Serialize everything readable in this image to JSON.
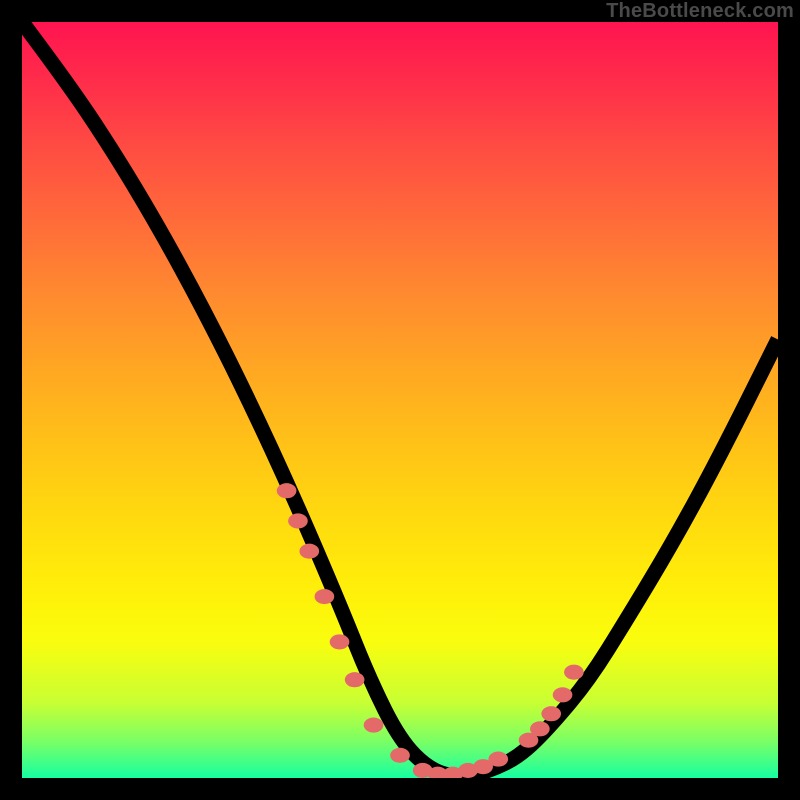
{
  "watermark": "TheBottleneck.com",
  "chart_data": {
    "type": "line",
    "title": "",
    "xlabel": "",
    "ylabel": "",
    "xlim": [
      0,
      100
    ],
    "ylim": [
      0,
      100
    ],
    "grid": false,
    "legend": false,
    "series": [
      {
        "name": "bottleneck-curve",
        "x": [
          0,
          6,
          12,
          18,
          24,
          30,
          36,
          42,
          46,
          50,
          54,
          58,
          62,
          66,
          70,
          75,
          80,
          86,
          92,
          100
        ],
        "y": [
          100,
          92,
          83,
          73,
          62,
          50,
          37,
          23,
          13,
          5,
          1,
          0,
          1,
          3,
          7,
          13,
          21,
          31,
          42,
          58
        ]
      }
    ],
    "markers": {
      "name": "highlighted-points",
      "color": "#e46a6a",
      "x": [
        35,
        36.5,
        38,
        40,
        42,
        44,
        46.5,
        50,
        53,
        55,
        57,
        59,
        61,
        63,
        67,
        68.5,
        70,
        71.5,
        73
      ],
      "y": [
        38,
        34,
        30,
        24,
        18,
        13,
        7,
        3,
        1,
        0.5,
        0.5,
        1,
        1.5,
        2.5,
        5,
        6.5,
        8.5,
        11,
        14
      ]
    },
    "background_gradient": {
      "top": "#ff1450",
      "bottom": "#16ffa1"
    }
  }
}
